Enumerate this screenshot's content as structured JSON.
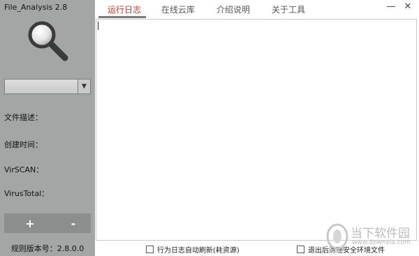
{
  "app": {
    "title": "File_Analysis 2.8"
  },
  "sidebar": {
    "select_value": "",
    "select_arrow_icon": "triangle-down",
    "info_labels": [
      "文件描述：",
      "创建时间：",
      "VirSCAN：",
      "VirusTotal："
    ],
    "zoom_in_label": "+",
    "zoom_out_label": "-",
    "rule_version": "规则版本号：2.8.0.0"
  },
  "tabs": [
    {
      "label": "运行日志",
      "active": true
    },
    {
      "label": "在线云库",
      "active": false
    },
    {
      "label": "介绍说明",
      "active": false
    },
    {
      "label": "关于工具",
      "active": false
    }
  ],
  "window": {
    "minimize_label": "—",
    "close_label": "✕"
  },
  "log": {
    "content": ""
  },
  "options": {
    "auto_refresh_label": "行为日志自动刷新(耗资源)",
    "auto_refresh_checked": false,
    "clean_on_exit_label": "退出后清理安全环境文件",
    "clean_on_exit_checked": false
  },
  "watermark": {
    "text": "当下软件园",
    "url": "www.downxia.com"
  },
  "colors": {
    "sidebar_bg": "#a4a6a5",
    "active_tab": "#c0392b",
    "tab_text": "#555555",
    "zoom_bar": "#8c8e8d"
  }
}
